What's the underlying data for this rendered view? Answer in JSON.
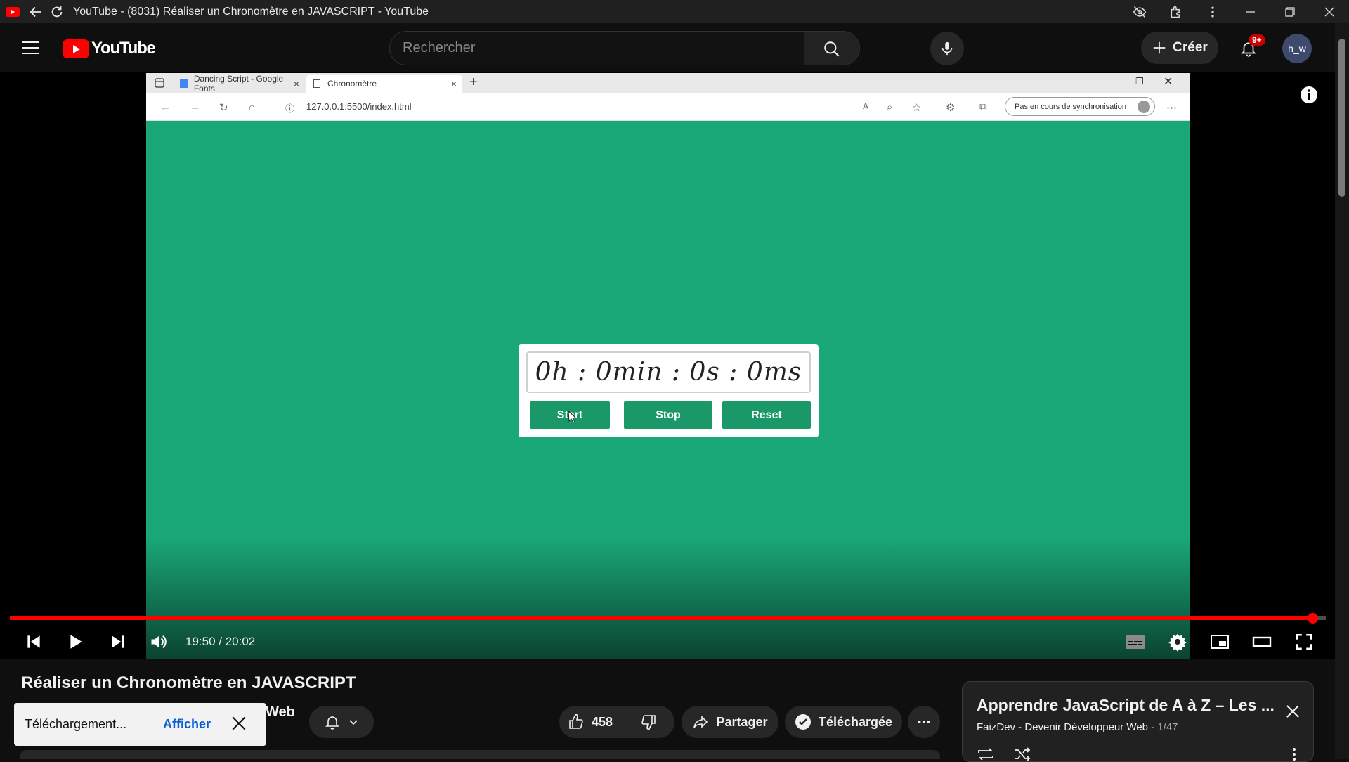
{
  "window": {
    "title": "YouTube - (8031) Réaliser un Chronomètre en JAVASCRIPT - YouTube"
  },
  "header": {
    "logo_text": "YouTube",
    "search_placeholder": "Rechercher",
    "create_label": "Créer",
    "notifications_badge": "9+",
    "avatar_text": "h_w"
  },
  "recorded_browser": {
    "tabs": [
      {
        "label": "Dancing Script - Google Fonts"
      },
      {
        "label": "Chronomètre"
      }
    ],
    "url": "127.0.0.1:5500/index.html",
    "sync_label": "Pas en cours de synchronisation"
  },
  "stopwatch": {
    "display": "0h : 0min : 0s : 0ms",
    "buttons": {
      "start": "Start",
      "stop": "Stop",
      "reset": "Reset"
    }
  },
  "player": {
    "current_time": "19:50",
    "duration": "20:02",
    "time_display": "19:50 / 20:02",
    "progress_fraction": 0.99
  },
  "video": {
    "title": "Réaliser un Chronomètre en JAVASCRIPT",
    "channel_partial": "Web",
    "likes": "458",
    "share_label": "Partager",
    "download_label": "Téléchargée"
  },
  "toast": {
    "message": "Téléchargement...",
    "action": "Afficher"
  },
  "playlist": {
    "title": "Apprendre JavaScript de A à Z – Les ...",
    "channel": "FaizDev - Devenir Développeur Web",
    "position": " - 1/47"
  },
  "colors": {
    "accent_red": "#ff0000",
    "video_bg": "#1aa878",
    "button_green": "#1a9868",
    "link_blue": "#065fd4"
  }
}
